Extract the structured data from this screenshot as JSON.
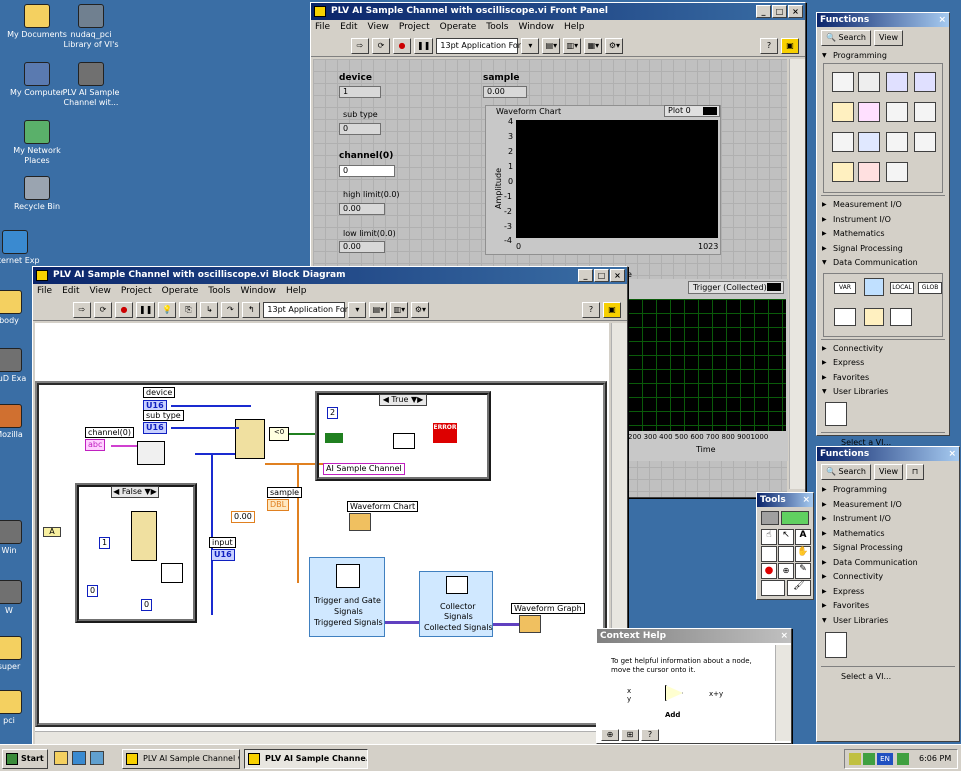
{
  "desktop": {
    "icons": [
      {
        "label": "My Documents"
      },
      {
        "label": "nudaq_pci Library of VI's"
      },
      {
        "label": "My Computer"
      },
      {
        "label": "PLV AI Sample Channel wit..."
      },
      {
        "label": "My Network Places"
      },
      {
        "label": "Recycle Bin"
      },
      {
        "label": "Internet Exp"
      },
      {
        "label": "body"
      },
      {
        "label": "NuD Exa"
      },
      {
        "label": "Mozilla"
      },
      {
        "label": "Win"
      },
      {
        "label": "W"
      },
      {
        "label": "super"
      },
      {
        "label": "pci"
      }
    ]
  },
  "front_panel": {
    "title": "PLV AI Sample Channel with oscilliscope.vi Front Panel",
    "menu": [
      "File",
      "Edit",
      "View",
      "Project",
      "Operate",
      "Tools",
      "Window",
      "Help"
    ],
    "font_select": "13pt Application Font",
    "device_label": "device",
    "device_value": "1",
    "sub_type_label": "sub type",
    "sub_type_value": "0",
    "channel_label": "channel(0)",
    "channel_value": "0",
    "high_limit_label": "high limit(0.0)",
    "high_limit_value": "0.00",
    "low_limit_label": "low limit(0.0)",
    "low_limit_value": "0.00",
    "sample_label": "sample",
    "sample_value": "0.00",
    "waveform_chart_label": "Waveform Chart",
    "plot_legend": "Plot 0",
    "amplitude_label": "Amplitude",
    "y_ticks": [
      "4",
      "3",
      "2",
      "1",
      "0",
      "-1",
      "-2",
      "-3",
      "-4"
    ],
    "x_start": "0",
    "x_end": "1023",
    "trigger_legend": "Trigger (Collected)",
    "graph_x_ticks": "200 300 400 500 600 700 800 9001000",
    "graph_x_label": "Time",
    "hidden_label_fragment": "e"
  },
  "block_diagram": {
    "title": "PLV AI Sample Channel with oscilliscope.vi Block Diagram",
    "menu": [
      "File",
      "Edit",
      "View",
      "Project",
      "Operate",
      "Tools",
      "Window",
      "Help"
    ],
    "font_select": "13pt Application Font",
    "device_label": "device",
    "device_term": "U16",
    "sub_type_label": "sub type",
    "sub_type_term": "U16",
    "channel_label": "channel(0)",
    "channel_term": "abc",
    "case_true": "True",
    "case_false": "False",
    "const_2": "2",
    "const_1": "1",
    "const_0": "0",
    "const_0b": "0",
    "error_label": "ERROR",
    "ai_sample_channel": "AI Sample Channel",
    "sample_label": "sample",
    "sample_term": "DBL",
    "const_000": "0.00",
    "input_label": "input",
    "input_term": "U16",
    "waveform_chart": "Waveform Chart",
    "trigger_gate": "Trigger and Gate",
    "signals": "Signals",
    "triggered_signals": "Triggered Signals",
    "collector": "Collector",
    "collected_signals": "Collected Signals",
    "waveform_graph": "Waveform Graph",
    "lt0": "<0"
  },
  "functions_palette_1": {
    "title": "Functions",
    "search": "Search",
    "view": "View",
    "programming": "Programming",
    "items": [
      "Measurement I/O",
      "Instrument I/O",
      "Mathematics",
      "Signal Processing",
      "Data Communication"
    ],
    "dc_icons": [
      "VAR",
      "LOCAL",
      "GLOB"
    ],
    "items2": [
      "Connectivity",
      "Express",
      "Favorites",
      "User Libraries"
    ],
    "select_vi": "Select a VI..."
  },
  "functions_palette_2": {
    "title": "Functions",
    "search": "Search",
    "view": "View",
    "items": [
      "Programming",
      "Measurement I/O",
      "Instrument I/O",
      "Mathematics",
      "Signal Processing",
      "Data Communication",
      "Connectivity",
      "Express",
      "Favorites",
      "User Libraries"
    ],
    "select_vi": "Select a VI..."
  },
  "tools_palette": {
    "title": "Tools"
  },
  "context_help": {
    "title": "Context Help",
    "text": "To get helpful information about a node, move the cursor onto it.",
    "x_label": "x",
    "y_label": "y",
    "out_label": "x+y",
    "node_label": "Add"
  },
  "taskbar": {
    "start": "Start",
    "tasks": [
      "PLV AI Sample Channel wi...",
      "PLV AI Sample Channe..."
    ],
    "lang": "EN",
    "time": "6:06 PM"
  }
}
